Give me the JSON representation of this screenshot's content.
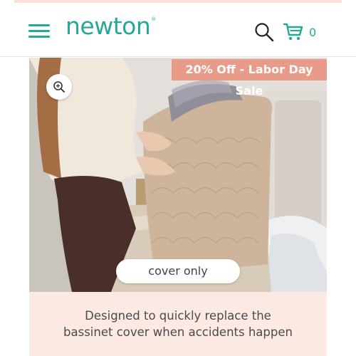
{
  "header": {
    "logo_text": "newton",
    "logo_mark": "®",
    "menu_icon": "hamburger-menu-icon",
    "search_icon": "search-icon",
    "cart_icon": "cart-icon",
    "cart_count": "0",
    "brand_color": "#27a69a"
  },
  "promo": {
    "banner_text": "20% Off - Labor Day Sale",
    "banner_color": "#e99b8a"
  },
  "hero": {
    "zoom_icon": "zoom-in-icon",
    "caption": "cover only"
  },
  "description": {
    "line1": "Designed to quickly replace the",
    "line2": "bassinet cover when accidents happen",
    "background_color": "#fce9e4"
  }
}
